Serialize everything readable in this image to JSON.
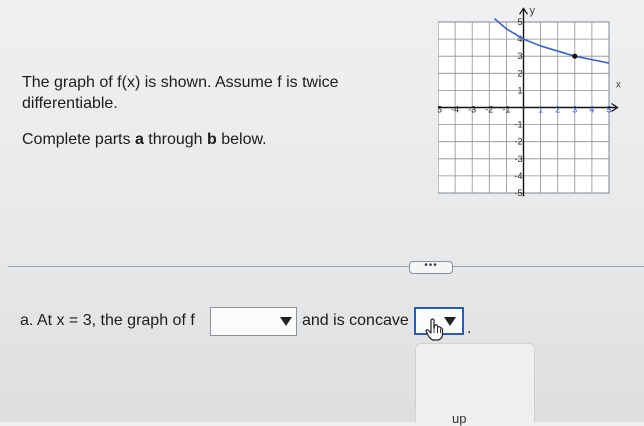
{
  "question": {
    "prompt": "The graph of f(x) is shown. Assume f is twice differentiable.",
    "instructions_pre": "Complete parts ",
    "instructions_a": "a",
    "instructions_mid": " through ",
    "instructions_b": "b",
    "instructions_post": " below.",
    "more_label": "•••"
  },
  "part_a": {
    "lead": "a. At x = 3, the graph of f",
    "answer_value": "",
    "concave_label": "and is concave",
    "concave_value": "",
    "terminator": ".",
    "popup_option_partial": "up"
  },
  "graph": {
    "x_axis_label": "x",
    "y_axis_label": "y",
    "x_ticks": [
      "-5",
      "-4",
      "-3",
      "-2",
      "-1",
      "1",
      "2",
      "3",
      "4",
      "5"
    ],
    "y_ticks": [
      "5",
      "4",
      "3",
      "2",
      "1",
      "-1",
      "-2",
      "-3",
      "-4",
      "-5"
    ],
    "curve_color": "#3a63c8",
    "curve_points": [
      [
        -1.7,
        5.2
      ],
      [
        -1,
        4.6
      ],
      [
        0,
        4.0
      ],
      [
        1,
        3.6
      ],
      [
        2,
        3.3
      ],
      [
        3,
        3.0
      ],
      [
        4,
        2.8
      ],
      [
        5,
        2.6
      ]
    ],
    "marked_point": [
      3,
      3.0
    ]
  }
}
